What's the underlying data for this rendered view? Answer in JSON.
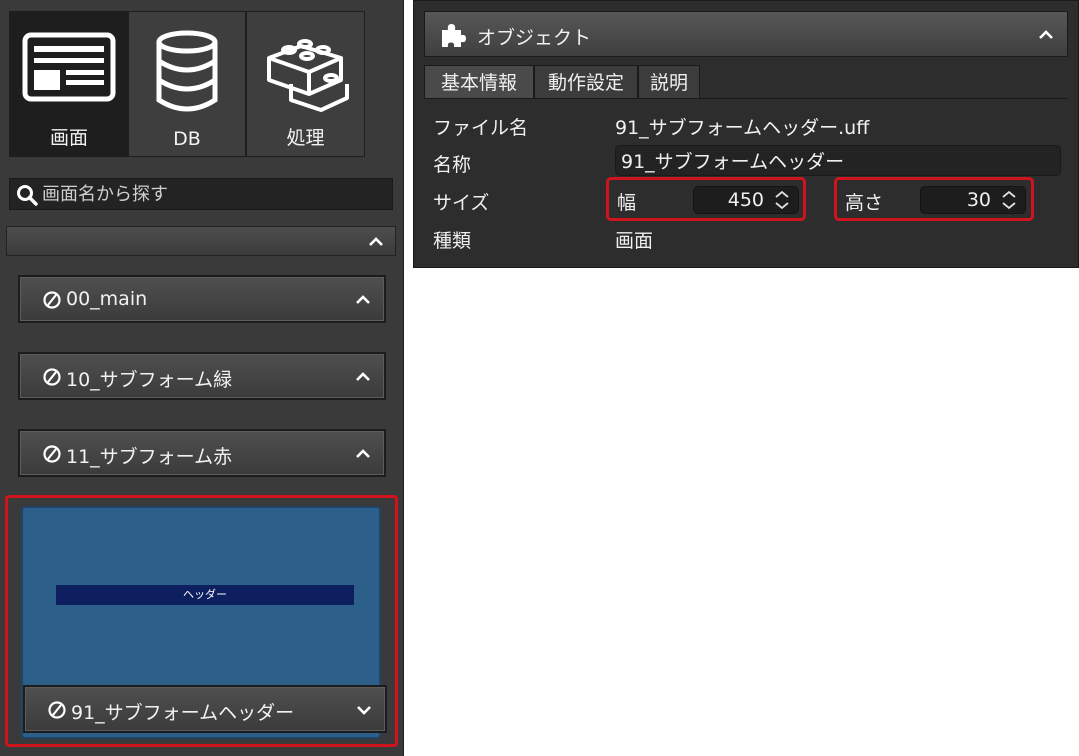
{
  "left_panel": {
    "nav_buttons": [
      {
        "label": "画面",
        "icon": "screen-layout-icon",
        "active": true
      },
      {
        "label": "DB",
        "icon": "database-icon",
        "active": false
      },
      {
        "label": "処理",
        "icon": "blocks-icon",
        "active": false
      }
    ],
    "search": {
      "placeholder": "画面名から探す",
      "icon": "search-icon"
    },
    "group_header": {
      "label": ""
    },
    "forms": [
      {
        "name": "00_main",
        "expanded": false
      },
      {
        "name": "10_サブフォーム緑",
        "expanded": false
      },
      {
        "name": "11_サブフォーム赤",
        "expanded": false
      }
    ],
    "selected_form": {
      "name": "91_サブフォームヘッダー",
      "preview_header_text": "ヘッダー",
      "expanded": true
    }
  },
  "object_panel": {
    "title": "オブジェクト",
    "icon": "puzzle-icon",
    "tabs": [
      {
        "label": "基本情報",
        "active": true
      },
      {
        "label": "動作設定",
        "active": false
      },
      {
        "label": "説明",
        "active": false
      }
    ],
    "properties": {
      "file_name_label": "ファイル名",
      "file_name_value": "91_サブフォームヘッダー.uff",
      "name_label": "名称",
      "name_value": "91_サブフォームヘッダー",
      "size_label": "サイズ",
      "width_label": "幅",
      "width_value": "450",
      "height_label": "高さ",
      "height_value": "30",
      "type_label": "種類",
      "type_value": "画面"
    }
  },
  "colors": {
    "highlight": "#d0141e",
    "preview_bg": "#2c5f8a",
    "preview_header": "#0d1f5e"
  }
}
